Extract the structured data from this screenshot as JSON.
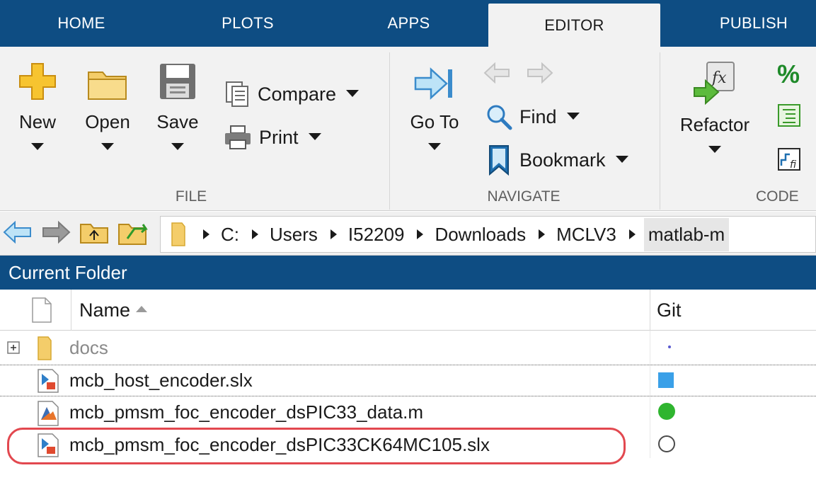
{
  "tabs": {
    "home": "HOME",
    "plots": "PLOTS",
    "apps": "APPS",
    "editor": "EDITOR",
    "publish": "PUBLISH",
    "active": "EDITOR"
  },
  "ribbon": {
    "file": {
      "label": "FILE",
      "new": "New",
      "open": "Open",
      "save": "Save",
      "compare": "Compare",
      "print": "Print"
    },
    "navigate": {
      "label": "NAVIGATE",
      "goto": "Go To",
      "find": "Find",
      "bookmark": "Bookmark"
    },
    "code": {
      "label": "CODE",
      "refactor": "Refactor"
    }
  },
  "address": {
    "crumbs": [
      "C:",
      "Users",
      "I52209",
      "Downloads",
      "MCLV3",
      "matlab-m"
    ]
  },
  "panel": {
    "title": "Current Folder",
    "name_header": "Name",
    "git_header": "Git",
    "rows": [
      {
        "name": "docs",
        "type": "folder",
        "git": "dot"
      },
      {
        "name": "mcb_host_encoder.slx",
        "type": "slx",
        "git": "modified"
      },
      {
        "name": "mcb_pmsm_foc_encoder_dsPIC33_data.m",
        "type": "m",
        "git": "unmodified"
      },
      {
        "name": "mcb_pmsm_foc_encoder_dsPIC33CK64MC105.slx",
        "type": "slx",
        "git": "untracked"
      }
    ]
  },
  "colors": {
    "tab_bar": "#0e4d83",
    "ribbon_bg": "#f2f2f2",
    "highlight": "#e2484f",
    "git_modified": "#3aa0e8",
    "git_unmodified": "#2fb52f"
  }
}
